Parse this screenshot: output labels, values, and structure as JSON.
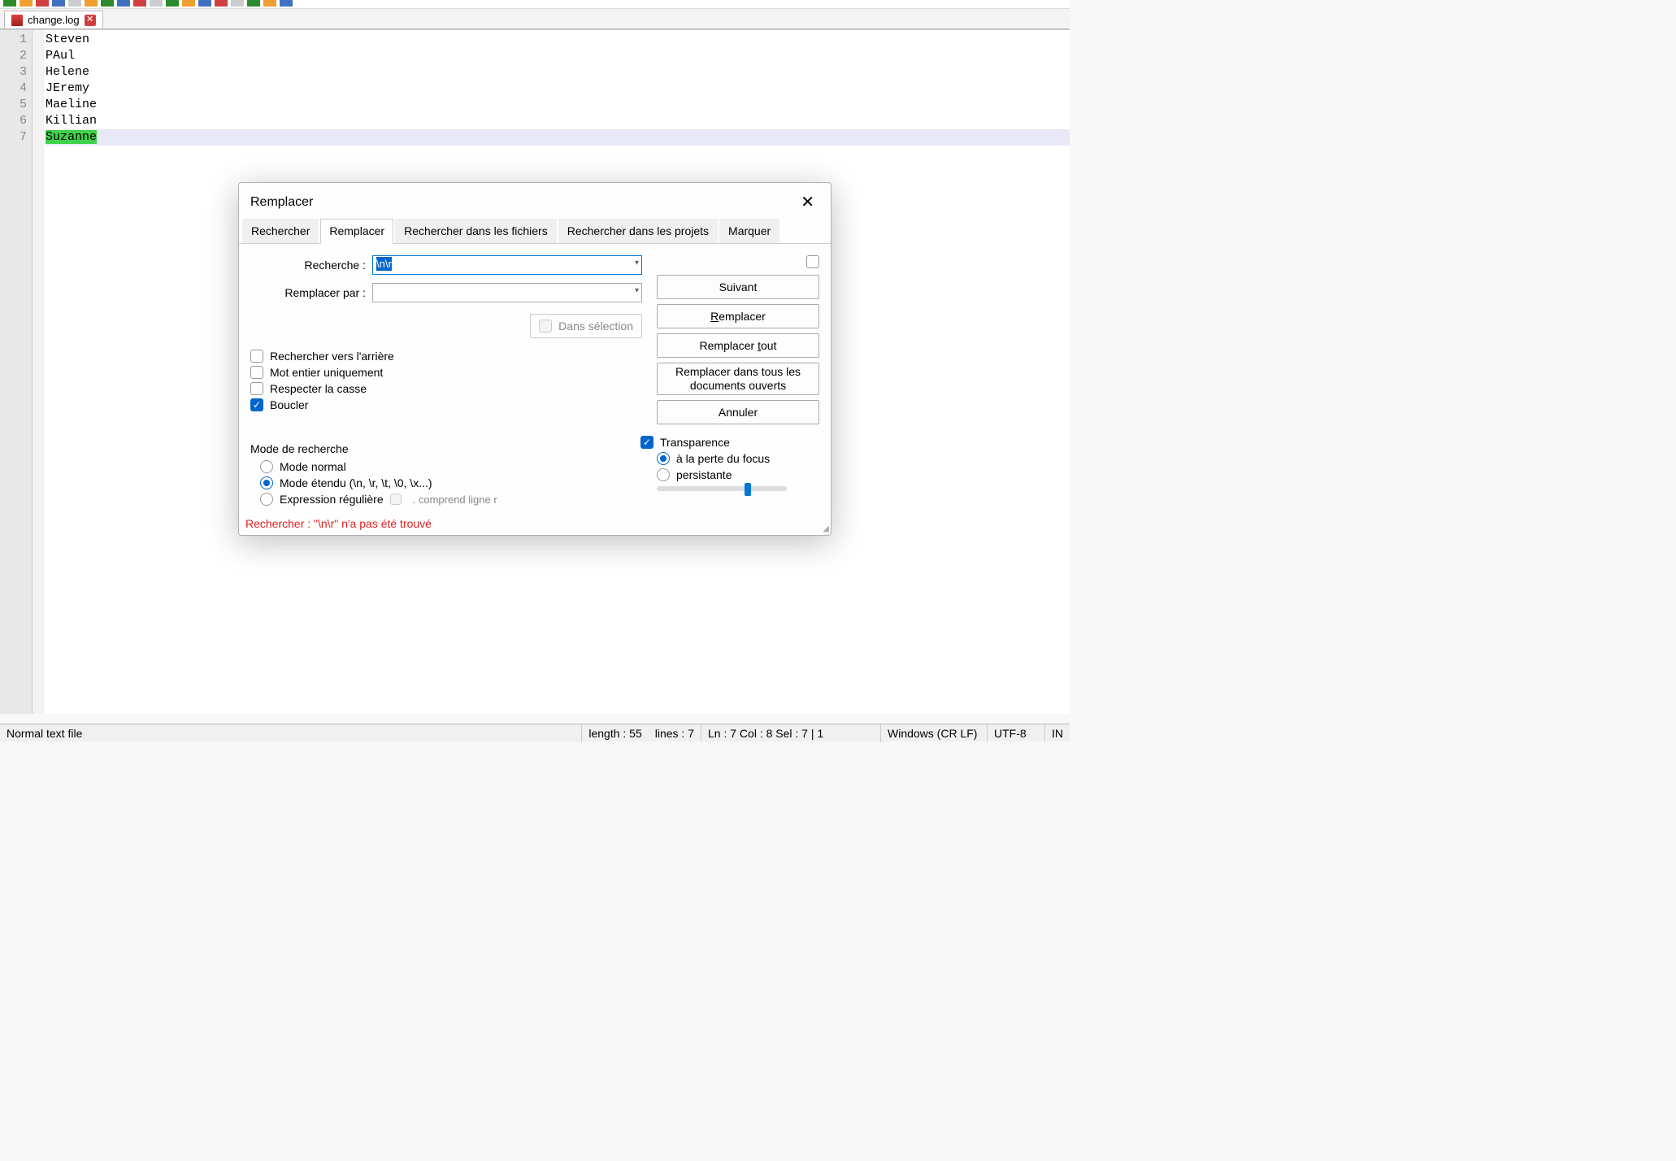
{
  "tab": {
    "filename": "change.log"
  },
  "editor": {
    "gutter": [
      "1",
      "2",
      "3",
      "4",
      "5",
      "6",
      "7"
    ],
    "lines": [
      "Steven",
      "PAul",
      "Helene",
      "JEremy",
      "Maeline",
      "Killian",
      "Suzanne"
    ],
    "highlight_line_index": 6
  },
  "statusbar": {
    "filetype": "Normal text file",
    "length_label": "length : 55",
    "lines_label": "lines : 7",
    "pos": "Ln : 7    Col : 8    Sel : 7 | 1",
    "eol": "Windows (CR LF)",
    "encoding": "UTF-8",
    "ins": "IN"
  },
  "dialog": {
    "title": "Remplacer",
    "tabs": [
      "Rechercher",
      "Remplacer",
      "Rechercher dans les fichiers",
      "Rechercher dans les projets",
      "Marquer"
    ],
    "active_tab": 1,
    "search_label": "Recherche :",
    "search_value": "\\n\\r",
    "replace_label": "Remplacer par :",
    "replace_value": "",
    "in_selection": "Dans sélection",
    "buttons": {
      "next": "Suivant",
      "replace": "Remplacer",
      "replace_all": "Remplacer tout",
      "replace_all_docs": "Remplacer dans tous les documents ouverts",
      "cancel": "Annuler"
    },
    "options": {
      "backward": "Rechercher vers l'arrière",
      "whole_word": "Mot entier uniquement",
      "match_case": "Respecter la casse",
      "wrap": "Boucler"
    },
    "mode_label": "Mode de recherche",
    "modes": {
      "normal": "Mode normal",
      "extended": "Mode étendu (\\n, \\r, \\t, \\0, \\x...)",
      "regex": "Expression régulière",
      "regex_sub": ". comprend ligne r"
    },
    "transparency": {
      "label": "Transparence",
      "focus_loss": "à la perte du focus",
      "persistent": "persistante"
    },
    "status": "Rechercher : \"\\n\\r\" n'a pas été trouvé"
  }
}
